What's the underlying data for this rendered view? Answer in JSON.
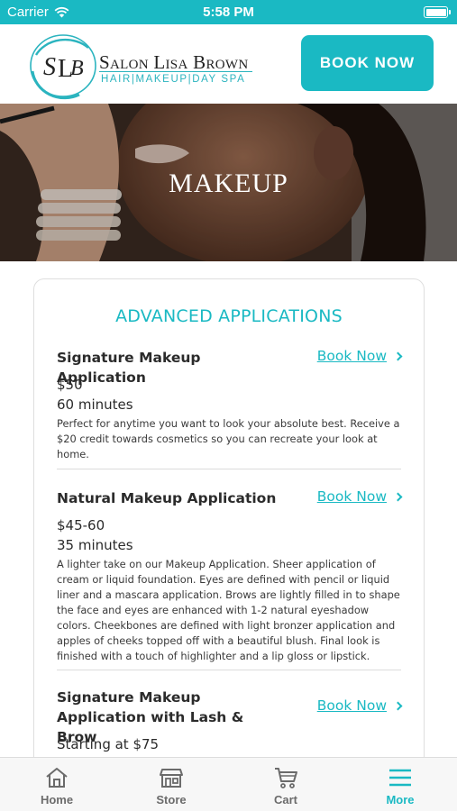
{
  "status_bar": {
    "carrier": "Carrier",
    "time": "5:58 PM"
  },
  "header": {
    "logo_name": "Salon Lisa Brown",
    "logo_tagline": "HAIR|MAKEUP|DAY SPA",
    "book_now_label": "BOOK NOW"
  },
  "hero": {
    "title": "MAKEUP"
  },
  "section": {
    "title": "ADVANCED APPLICATIONS",
    "services": [
      {
        "name": "Signature Makeup Application",
        "book_label": "Book Now",
        "price": "$50",
        "duration": "60 minutes",
        "description": "Perfect for anytime you want to look your absolute best. Receive a $20 credit towards cosmetics so you can recreate your look at home."
      },
      {
        "name": "Natural Makeup Application",
        "book_label": "Book Now",
        "price": "$45-60",
        "duration": "35 minutes",
        "description": "A lighter take on our Makeup Application. Sheer application of cream or liquid foundation. Eyes are defined with pencil or liquid liner and a mascara application. Brows are lightly filled in to shape the face and eyes are enhanced with 1-2 natural eyeshadow colors. Cheekbones are defined with light bronzer application and apples of cheeks topped off with a beautiful blush. Final look is finished with a touch of highlighter and a lip gloss or lipstick."
      },
      {
        "name": "Signature Makeup Application with Lash & Brow",
        "book_label": "Book Now",
        "price": "Starting at $75"
      }
    ]
  },
  "tab_bar": {
    "items": [
      {
        "label": "Home",
        "icon": "home-icon"
      },
      {
        "label": "Store",
        "icon": "store-icon"
      },
      {
        "label": "Cart",
        "icon": "cart-icon"
      },
      {
        "label": "More",
        "icon": "menu-icon",
        "active": true
      }
    ]
  },
  "colors": {
    "accent": "#1ab9c3",
    "text": "#2b2b2b",
    "tab_inactive": "#6b6b6b"
  }
}
